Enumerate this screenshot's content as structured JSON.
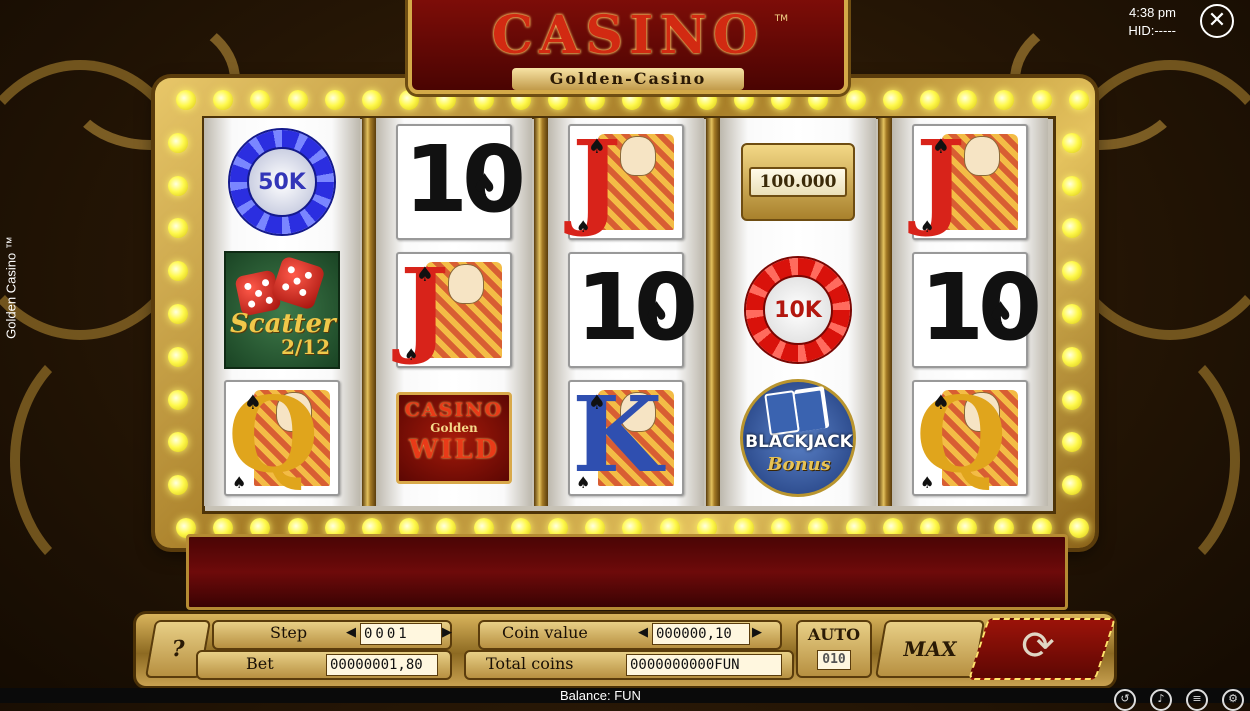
{
  "header": {
    "logo": "CASINO",
    "trademark": "TM",
    "subtitle": "Golden-Casino"
  },
  "status": {
    "time": "4:38 pm",
    "hid": "HID:-----"
  },
  "side_title": "Golden Casino ™",
  "close_icon": "close-icon",
  "reels": [
    [
      {
        "type": "chip",
        "color": "blue",
        "label": "50K"
      },
      {
        "type": "scatter",
        "label": "Scatter",
        "count": "2/12"
      },
      {
        "type": "face",
        "rank": "Q",
        "suit": "♠"
      }
    ],
    [
      {
        "type": "number",
        "rank": "10",
        "suit": "♠"
      },
      {
        "type": "face",
        "rank": "J",
        "suit": "♠"
      },
      {
        "type": "wild",
        "line1": "CASINO",
        "line2": "Golden",
        "line3": "WILD"
      }
    ],
    [
      {
        "type": "face",
        "rank": "J",
        "suit": "♠"
      },
      {
        "type": "number",
        "rank": "10",
        "suit": "♠"
      },
      {
        "type": "face",
        "rank": "K",
        "suit": "♠"
      }
    ],
    [
      {
        "type": "plaque",
        "label": "100.000"
      },
      {
        "type": "chip",
        "color": "red",
        "label": "10K"
      },
      {
        "type": "blackjack",
        "line1": "BLACKJACK",
        "line2": "Bonus"
      }
    ],
    [
      {
        "type": "face",
        "rank": "J",
        "suit": "♠"
      },
      {
        "type": "number",
        "rank": "10",
        "suit": "♠"
      },
      {
        "type": "face",
        "rank": "Q",
        "suit": "♠"
      }
    ]
  ],
  "controls": {
    "help": "?",
    "step_label": "Step",
    "step_value": "0001",
    "bet_label": "Bet",
    "bet_value": "00000001,80",
    "coin_value_label": "Coin value",
    "coin_value": "000000,10",
    "total_coins_label": "Total coins",
    "total_coins": "0000000000FUN",
    "auto_label": "AUTO",
    "auto_value": "010",
    "max_label": "MAX",
    "spin_icon": "spin-arrows-icon",
    "decrease_arrow": "◀",
    "increase_arrow": "▶"
  },
  "footer": {
    "balance": "Balance: FUN",
    "icons": [
      "history-icon",
      "sound-icon",
      "menu-icon",
      "settings-icon"
    ]
  },
  "colors": {
    "gold": "#d4a948",
    "red": "#7d0d08",
    "bulb": "#fff94d"
  }
}
